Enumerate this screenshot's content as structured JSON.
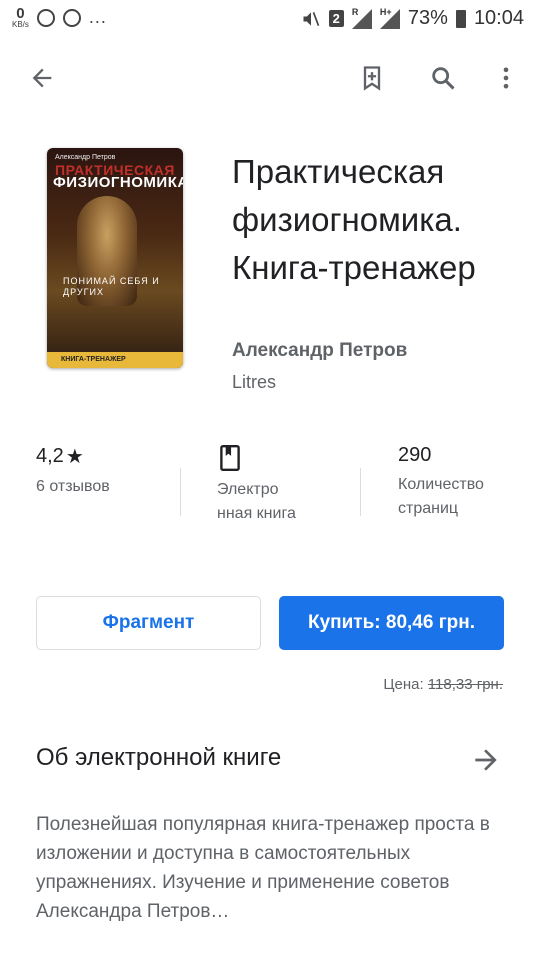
{
  "status_bar": {
    "speed_value": "0",
    "speed_unit": "KB/s",
    "more": "...",
    "sim_badge": "2",
    "net_r": "R",
    "net_h": "H+",
    "battery": "73%",
    "time": "10:04"
  },
  "toolbar": {
    "back_icon": "arrow-left-icon",
    "wishlist_icon": "bookmark-add-icon",
    "search_icon": "search-icon",
    "menu_icon": "more-vert-icon"
  },
  "book": {
    "cover_author": "Александр Петров",
    "cover_title_1": "ПРАКТИЧЕСКАЯ",
    "cover_title_2": "ФИЗИОГНОМИКА",
    "cover_mid": "ПОНИМАЙ СЕБЯ И ДРУГИХ",
    "cover_band": "КНИГА-ТРЕНАЖЕР",
    "title": "Практическая физиогномика. Книга-тренажер",
    "author": "Александр Петров",
    "publisher": "Litres"
  },
  "stats": {
    "rating_value": "4,2",
    "rating_star": "★",
    "reviews": "6 отзывов",
    "format_label": "Электро нная книга",
    "pages_value": "290",
    "pages_label": "Количество страниц"
  },
  "actions": {
    "sample_label": "Фрагмент",
    "buy_label": "Купить: 80,46 грн.",
    "price_label": "Цена:",
    "old_price": "118,33 грн."
  },
  "about": {
    "heading": "Об электронной книге",
    "description": "Полезнейшая популярная книга-тренажер проста в изложении и доступна в самостоятельных упражнениях. Изучение и применение советов Александра Петров…"
  },
  "colors": {
    "accent": "#1a73e8",
    "text_primary": "#202124",
    "text_secondary": "#5f6368"
  }
}
